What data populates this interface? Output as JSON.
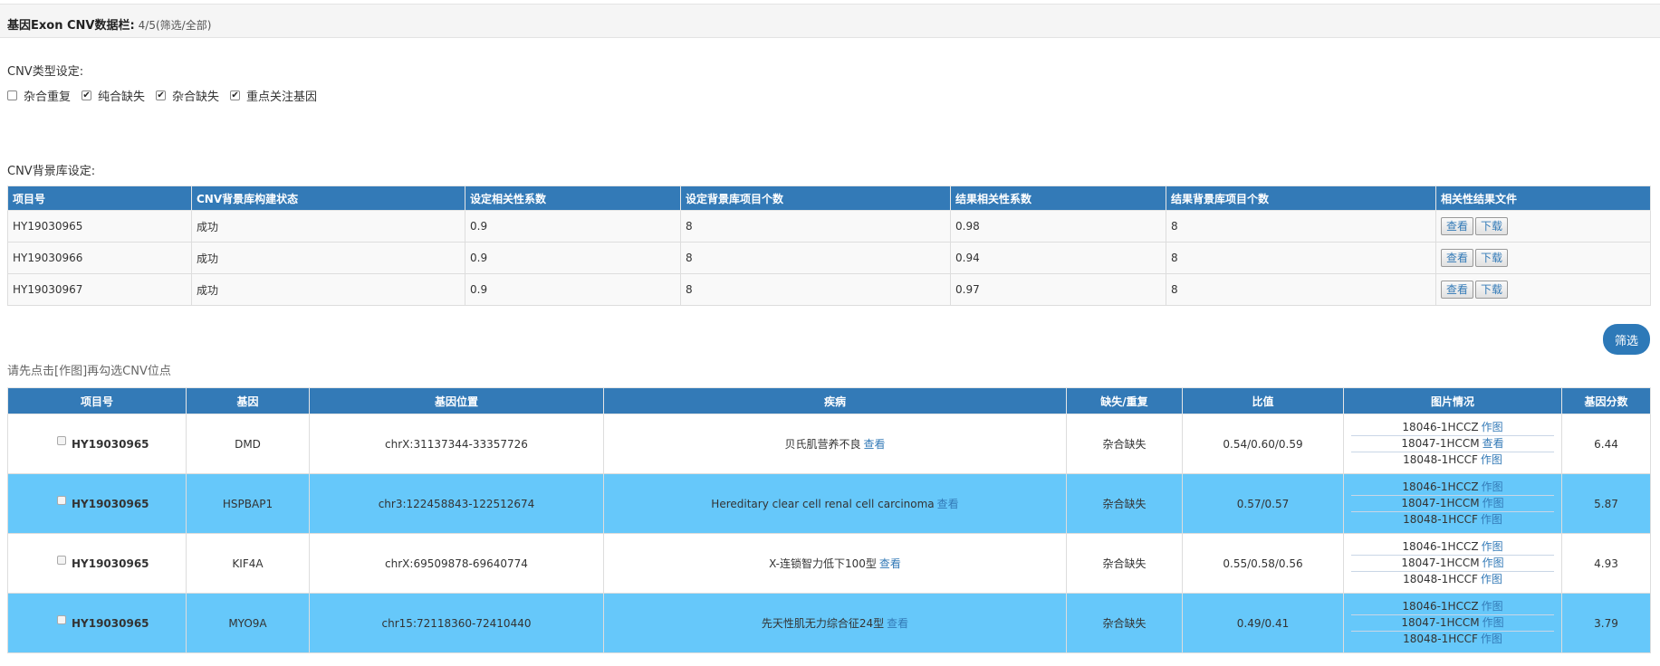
{
  "panel": {
    "title": "基因Exon CNV数据栏:",
    "count": "4/5(筛选/全部)"
  },
  "cnv_type": {
    "label": "CNV类型设定:",
    "options": [
      {
        "label": "杂合重复",
        "checked": false
      },
      {
        "label": "纯合缺失",
        "checked": true
      },
      {
        "label": "杂合缺失",
        "checked": true
      },
      {
        "label": "重点关注基因",
        "checked": true
      }
    ]
  },
  "background": {
    "label": "CNV背景库设定:",
    "headers": [
      "项目号",
      "CNV背景库构建状态",
      "设定相关性系数",
      "设定背景库项目个数",
      "结果相关性系数",
      "结果背景库项目个数",
      "相关性结果文件"
    ],
    "rows": [
      [
        "HY19030965",
        "成功",
        "0.9",
        "8",
        "0.98",
        "8"
      ],
      [
        "HY19030966",
        "成功",
        "0.9",
        "8",
        "0.94",
        "8"
      ],
      [
        "HY19030967",
        "成功",
        "0.9",
        "8",
        "0.97",
        "8"
      ]
    ],
    "view_label": "查看",
    "download_label": "下载"
  },
  "filter_button": "筛选",
  "hint": "请先点击[作图]再勾选CNV位点",
  "cnv": {
    "headers": [
      "项目号",
      "基因",
      "基因位置",
      "疾病",
      "缺失/重复",
      "比值",
      "图片情况",
      "基因分数"
    ],
    "view_label": "查看",
    "rows": [
      {
        "project": "HY19030965",
        "gene": "DMD",
        "position": "chrX:31137344-33357726",
        "disease": "贝氏肌营养不良",
        "type": "杂合缺失",
        "ratio": "0.54/0.60/0.59",
        "images": [
          {
            "id": "18046-1HCCZ",
            "action": "作图"
          },
          {
            "id": "18047-1HCCM",
            "action": "查看"
          },
          {
            "id": "18048-1HCCF",
            "action": "作图"
          }
        ],
        "score": "6.44"
      },
      {
        "project": "HY19030965",
        "gene": "HSPBAP1",
        "position": "chr3:122458843-122512674",
        "disease": "Hereditary clear cell renal cell carcinoma",
        "type": "杂合缺失",
        "ratio": "0.57/0.57",
        "images": [
          {
            "id": "18046-1HCCZ",
            "action": "作图"
          },
          {
            "id": "18047-1HCCM",
            "action": "作图"
          },
          {
            "id": "18048-1HCCF",
            "action": "作图"
          }
        ],
        "score": "5.87"
      },
      {
        "project": "HY19030965",
        "gene": "KIF4A",
        "position": "chrX:69509878-69640774",
        "disease": "X-连锁智力低下100型",
        "type": "杂合缺失",
        "ratio": "0.55/0.58/0.56",
        "images": [
          {
            "id": "18046-1HCCZ",
            "action": "作图"
          },
          {
            "id": "18047-1HCCM",
            "action": "作图"
          },
          {
            "id": "18048-1HCCF",
            "action": "作图"
          }
        ],
        "score": "4.93"
      },
      {
        "project": "HY19030965",
        "gene": "MYO9A",
        "position": "chr15:72118360-72410440",
        "disease": "先天性肌无力综合征24型",
        "type": "杂合缺失",
        "ratio": "0.49/0.41",
        "images": [
          {
            "id": "18046-1HCCZ",
            "action": "作图"
          },
          {
            "id": "18047-1HCCM",
            "action": "作图"
          },
          {
            "id": "18048-1HCCF",
            "action": "作图"
          }
        ],
        "score": "3.79"
      }
    ]
  }
}
